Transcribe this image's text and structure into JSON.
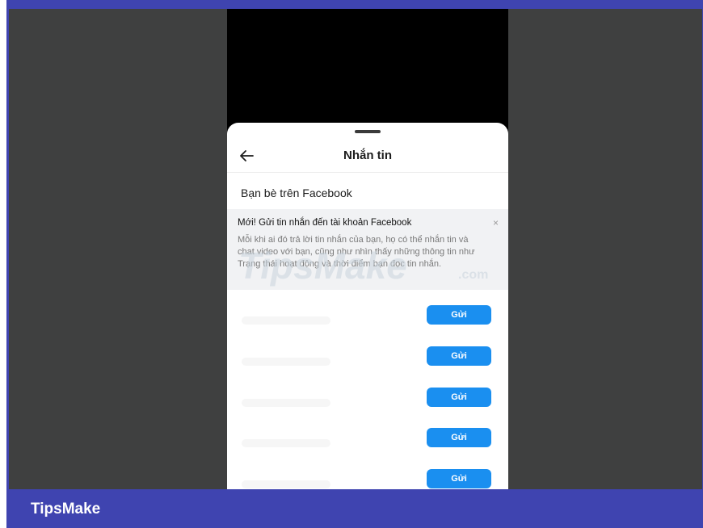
{
  "sheet": {
    "title": "Nhắn tin",
    "section_label": "Bạn bè trên Facebook"
  },
  "banner": {
    "title": "Mới! Gửi tin nhắn đến tài khoản Facebook",
    "close": "×",
    "body": "Mỗi khi ai đó trả lời tin nhắn của bạn, họ có thể nhắn tin và chat video với bạn, cũng như nhìn thấy những thông tin như Trạng thái hoạt động và thời điểm bạn đọc tin nhắn."
  },
  "watermark": {
    "brand": "TipsMake",
    "suffix": ".com"
  },
  "contacts": [
    {
      "send_label": "Gửi"
    },
    {
      "send_label": "Gửi"
    },
    {
      "send_label": "Gửi"
    },
    {
      "send_label": "Gửi"
    },
    {
      "send_label": "Gửi"
    }
  ],
  "footer": {
    "brand": "TipsMake"
  },
  "colors": {
    "frame": "#3f44b0",
    "stage": "#3f4040",
    "send_button": "#1a8ff0"
  }
}
